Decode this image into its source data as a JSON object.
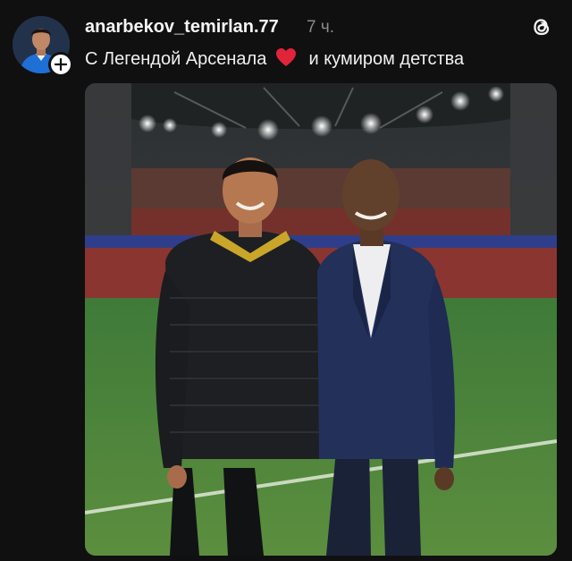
{
  "post": {
    "username": "anarbekov_temirlan.77",
    "time": "7 ч.",
    "caption_part1": "С Легендой Арсенала",
    "caption_part2": "и кумиром детства"
  },
  "icons": {
    "avatar": "profile-avatar",
    "follow": "plus-icon",
    "app": "threads-logo-icon",
    "emoji": "red-heart-icon"
  },
  "colors": {
    "background": "#101010",
    "heart": "#e0243a",
    "muted": "#8a8a8a"
  }
}
